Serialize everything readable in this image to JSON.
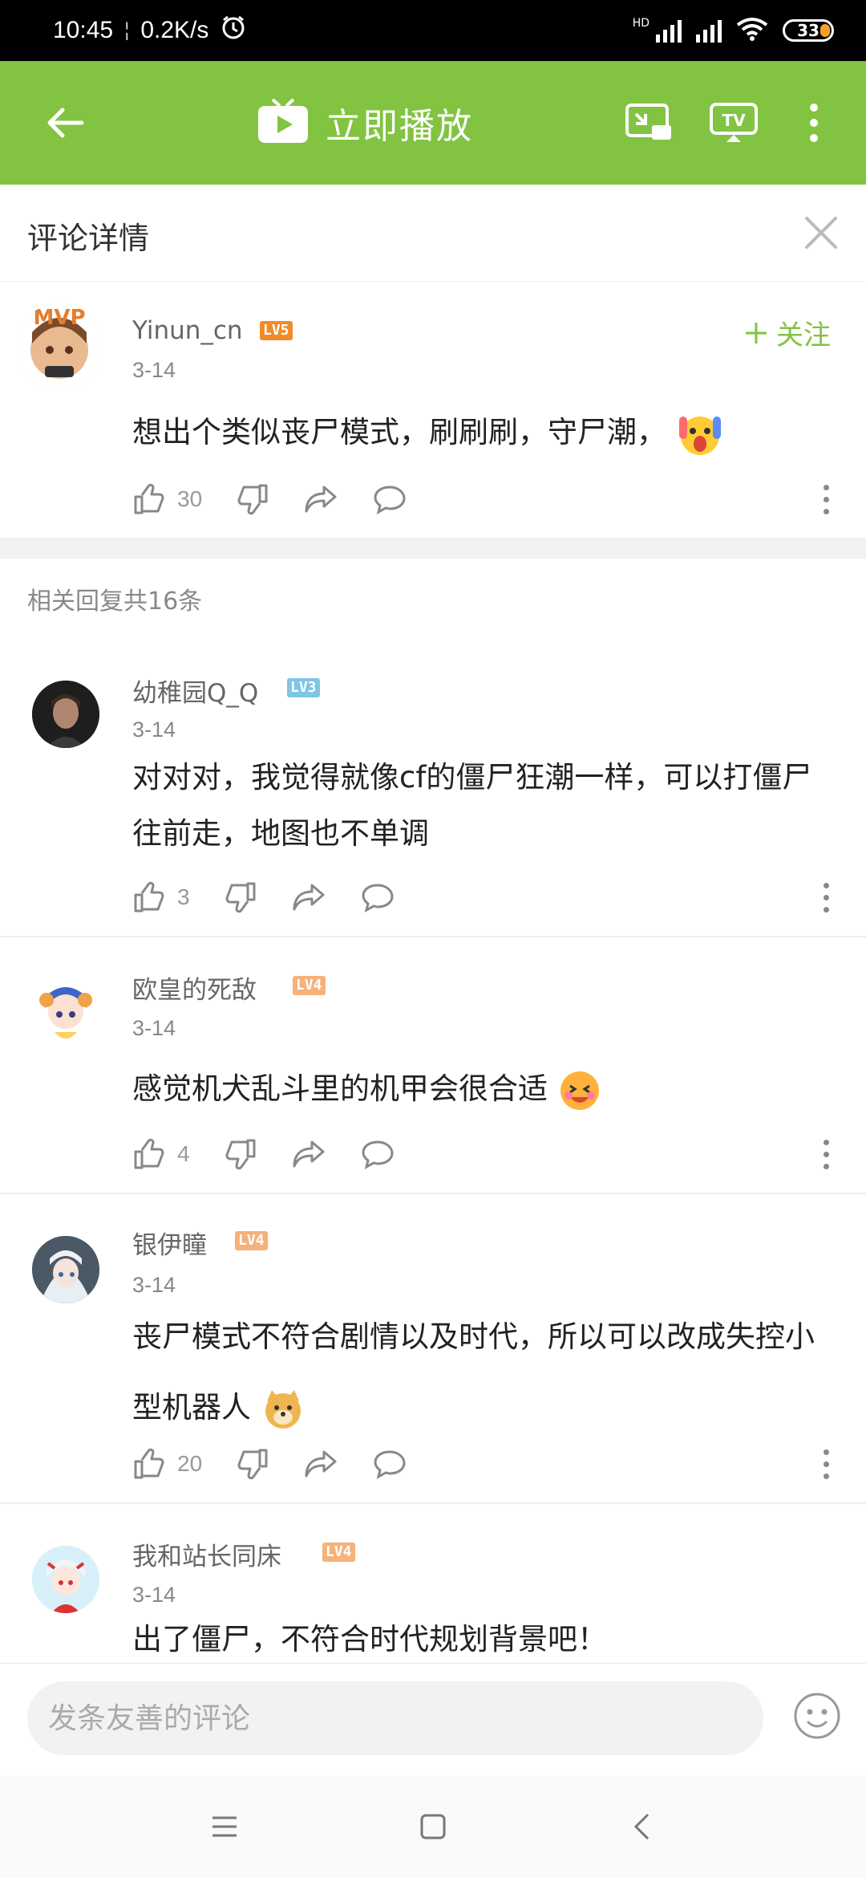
{
  "status_bar": {
    "time": "10:45",
    "separator": "¦",
    "speed": "0.2K/s",
    "hd": "HD",
    "battery": "33"
  },
  "top_bar": {
    "title": "立即播放",
    "tv_label": "TV"
  },
  "detail": {
    "title": "评论详情"
  },
  "main_comment": {
    "username": "Yinun_cn",
    "level": "LV5",
    "date": "3-14",
    "text": "想出个类似丧尸模式，刷刷刷，守尸潮，",
    "likes": "30",
    "follow_label": "关注"
  },
  "replies_header": "相关回复共16条",
  "replies": [
    {
      "username": "幼稚园Q_Q",
      "level": "LV3",
      "date": "3-14",
      "text": "对对对，我觉得就像cf的僵尸狂潮一样，可以打僵尸往前走，地图也不单调",
      "likes": "3"
    },
    {
      "username": "欧皇的死敌",
      "level": "LV4",
      "date": "3-14",
      "text": "感觉机犬乱斗里的机甲会很合适",
      "likes": "4"
    },
    {
      "username": "银伊瞳",
      "level": "LV4",
      "date": "3-14",
      "text": "丧尸模式不符合剧情以及时代，所以可以改成失控小型机器人",
      "likes": "20"
    },
    {
      "username": "我和站长同床",
      "level": "LV4",
      "date": "3-14",
      "text": "出了僵尸，不符合时代规划背景吧！",
      "likes": ""
    }
  ],
  "input": {
    "placeholder": "发条友善的评论",
    "value": ""
  },
  "colors": {
    "brand_green": "#82c341",
    "lv5": "#f08b2a",
    "lv3": "#7fc6e6",
    "lv4": "#f5b27a"
  }
}
